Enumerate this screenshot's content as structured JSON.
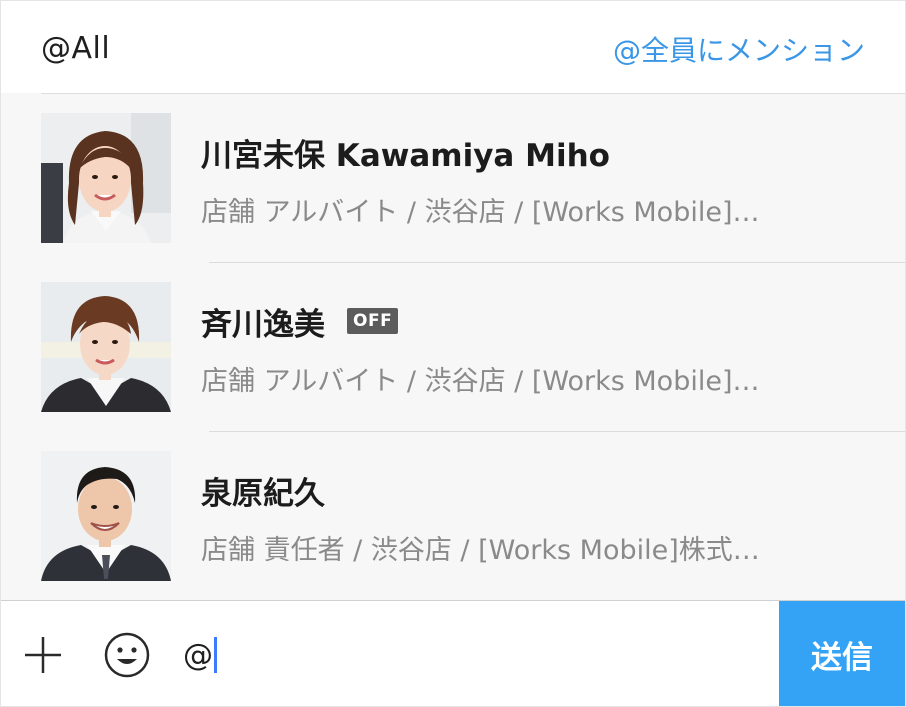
{
  "header": {
    "mention_all_label": "@All",
    "mention_everyone_link": "@全員にメンション"
  },
  "members": [
    {
      "name": "川宮未保 Kawamiya Miho",
      "status_badge": "",
      "detail": "店舗 アルバイト / 渋谷店 / [Works Mobile]…",
      "avatar": "female-portrait-long-hair"
    },
    {
      "name": "斉川逸美",
      "status_badge": "OFF",
      "detail": "店舗 アルバイト / 渋谷店 / [Works Mobile]…",
      "avatar": "female-portrait-short-hair"
    },
    {
      "name": "泉原紀久",
      "status_badge": "",
      "detail": "店舗 責任者 / 渋谷店 / [Works Mobile]株式…",
      "avatar": "male-portrait-suit"
    }
  ],
  "input_bar": {
    "input_value": "@",
    "send_label": "送信",
    "plus_icon": "plus-icon",
    "emoji_icon": "smiley-icon"
  },
  "colors": {
    "accent_link": "#3a96e6",
    "send_button": "#35a3f5",
    "badge_bg": "#5c5c5c",
    "caret": "#3a7bff"
  }
}
